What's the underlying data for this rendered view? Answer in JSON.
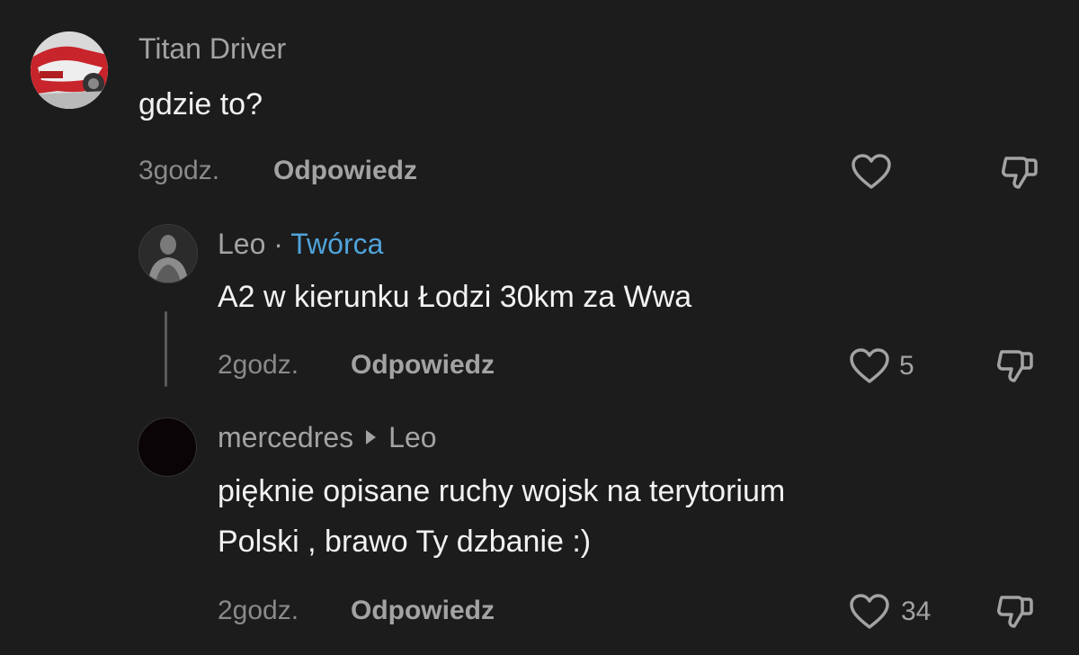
{
  "comments": [
    {
      "username": "Titan Driver",
      "text": "gdzie to?",
      "time": "3godz.",
      "reply_label": "Odpowiedz",
      "likes": ""
    },
    {
      "username": "Leo",
      "separator": " · ",
      "badge": "Twórca",
      "text": "A2 w kierunku Łodzi 30km za Wwa",
      "time": "2godz.",
      "reply_label": "Odpowiedz",
      "likes": "5"
    },
    {
      "username": "mercedres",
      "reply_to": "Leo",
      "text_line1": "pięknie opisane ruchy wojsk na terytorium",
      "text_line2": "Polski , brawo Ty dzbanie :)",
      "time": "2godz.",
      "reply_label": "Odpowiedz",
      "likes": "34"
    }
  ],
  "icons": {
    "like": "heart-outline-icon",
    "dislike": "thumbs-down-icon",
    "reply_arrow": "right-triangle-icon"
  },
  "colors": {
    "background": "#1c1c1c",
    "username": "#a3a3a3",
    "creator_badge": "#4fa3d9",
    "text": "#f2f2f2"
  }
}
